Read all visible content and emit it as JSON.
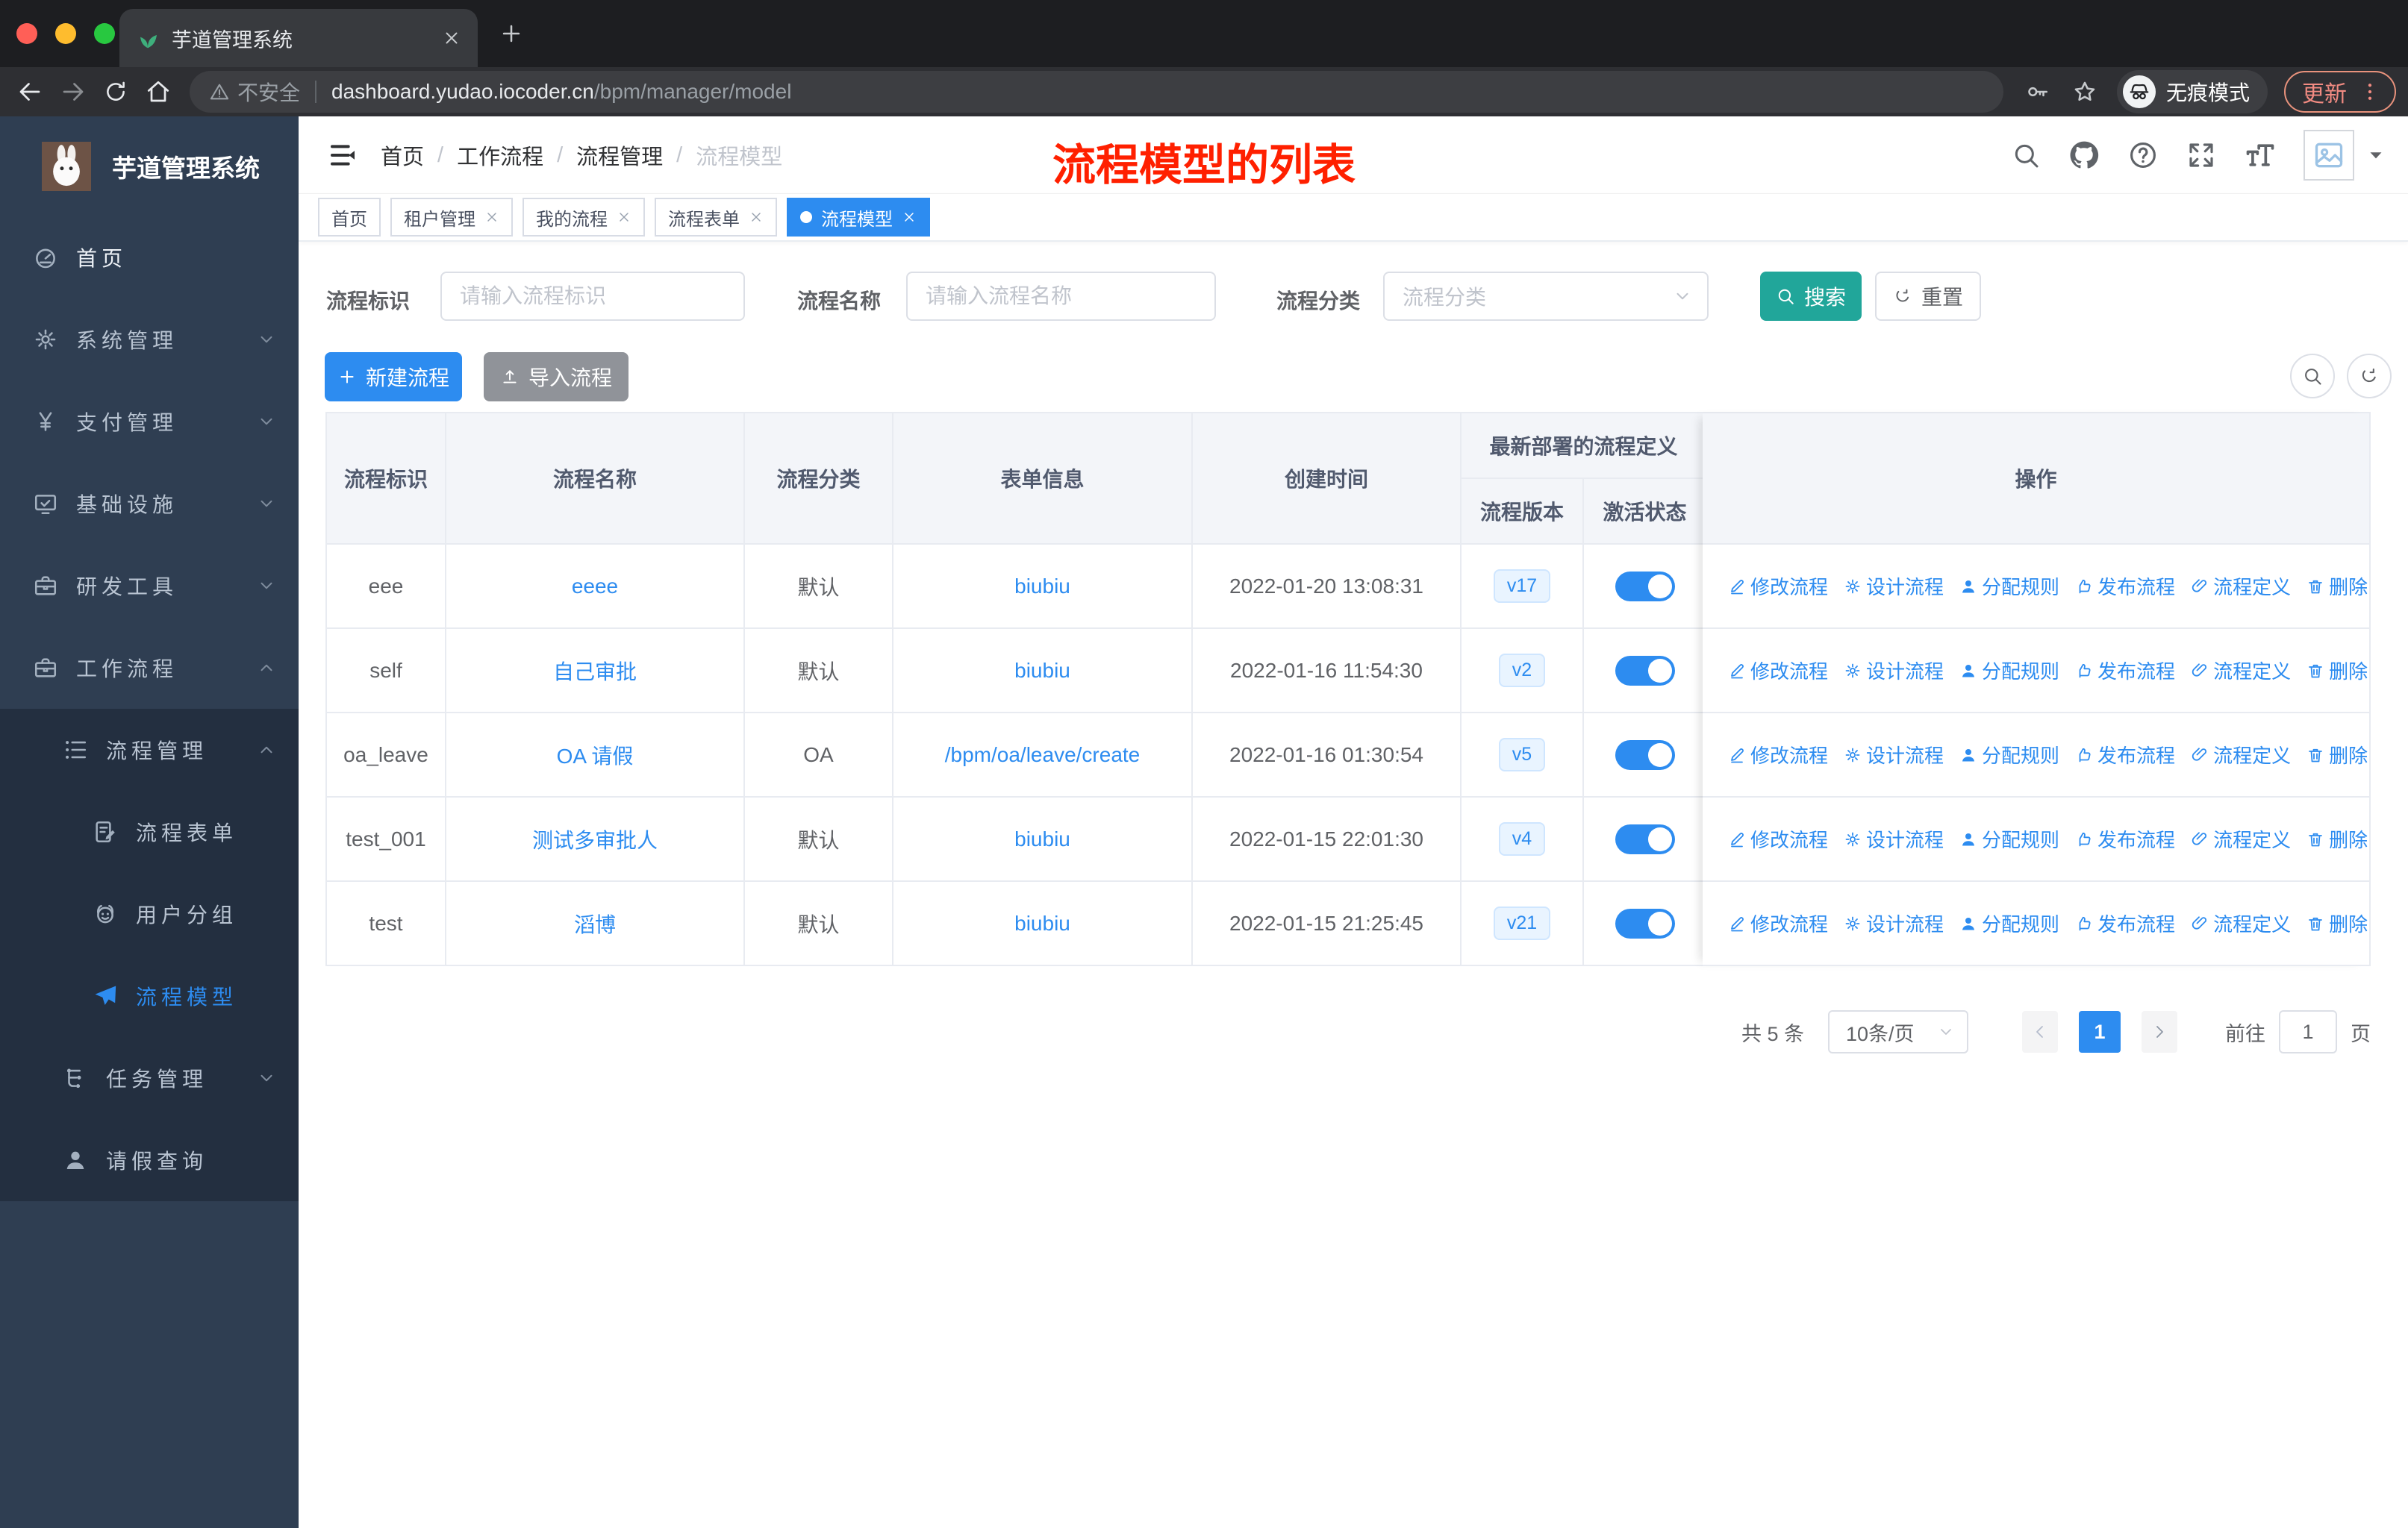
{
  "browser": {
    "tab_title": "芋道管理系统",
    "security_label": "不安全",
    "url_host": "dashboard.yudao.iocoder.cn",
    "url_path": "/bpm/manager/model",
    "incognito_label": "无痕模式",
    "update_label": "更新"
  },
  "sidebar": {
    "app_title": "芋道管理系统",
    "items": [
      {
        "label": "首页"
      },
      {
        "label": "系统管理"
      },
      {
        "label": "支付管理"
      },
      {
        "label": "基础设施"
      },
      {
        "label": "研发工具"
      },
      {
        "label": "工作流程"
      },
      {
        "label": "流程管理"
      },
      {
        "label": "流程表单"
      },
      {
        "label": "用户分组"
      },
      {
        "label": "流程模型"
      },
      {
        "label": "任务管理"
      },
      {
        "label": "请假查询"
      }
    ]
  },
  "header": {
    "breadcrumb": [
      "首页",
      "工作流程",
      "流程管理",
      "流程模型"
    ],
    "sep": "/",
    "annotation": "流程模型的列表"
  },
  "tags": [
    {
      "label": "首页"
    },
    {
      "label": "租户管理"
    },
    {
      "label": "我的流程"
    },
    {
      "label": "流程表单"
    },
    {
      "label": "流程模型"
    }
  ],
  "filters": {
    "id_label": "流程标识",
    "id_placeholder": "请输入流程标识",
    "name_label": "流程名称",
    "name_placeholder": "请输入流程名称",
    "category_label": "流程分类",
    "category_placeholder": "流程分类",
    "search": "搜索",
    "reset": "重置"
  },
  "actions": {
    "create": "新建流程",
    "import": "导入流程"
  },
  "table": {
    "columns": [
      "流程标识",
      "流程名称",
      "流程分类",
      "表单信息",
      "创建时间"
    ],
    "group_header": "最新部署的流程定义",
    "sub_columns": [
      "流程版本",
      "激活状态"
    ],
    "ops_header": "操作",
    "ops": [
      {
        "label": "修改流程"
      },
      {
        "label": "设计流程"
      },
      {
        "label": "分配规则"
      },
      {
        "label": "发布流程"
      },
      {
        "label": "流程定义"
      },
      {
        "label": "删除"
      }
    ],
    "rows": [
      {
        "id": "eee",
        "name": "eeee",
        "category": "默认",
        "form": "biubiu",
        "created": "2022-01-20 13:08:31",
        "version": "v17"
      },
      {
        "id": "self",
        "name": "自己审批",
        "category": "默认",
        "form": "biubiu",
        "created": "2022-01-16 11:54:30",
        "version": "v2"
      },
      {
        "id": "oa_leave",
        "name": "OA 请假",
        "category": "OA",
        "form": "/bpm/oa/leave/create",
        "created": "2022-01-16 01:30:54",
        "version": "v5"
      },
      {
        "id": "test_001",
        "name": "测试多审批人",
        "category": "默认",
        "form": "biubiu",
        "created": "2022-01-15 22:01:30",
        "version": "v4"
      },
      {
        "id": "test",
        "name": "滔博",
        "category": "默认",
        "form": "biubiu",
        "created": "2022-01-15 21:25:45",
        "version": "v21"
      }
    ]
  },
  "pagination": {
    "total": "共 5 条",
    "page_size": "10条/页",
    "current": "1",
    "goto_label": "前往",
    "goto_value": "1",
    "page_unit": "页"
  },
  "colors": {
    "accent_blue": "#2d8cf0",
    "teal": "#21a69a",
    "annotation_red": "#ff2000",
    "tag_active": "#2d8cf0"
  }
}
